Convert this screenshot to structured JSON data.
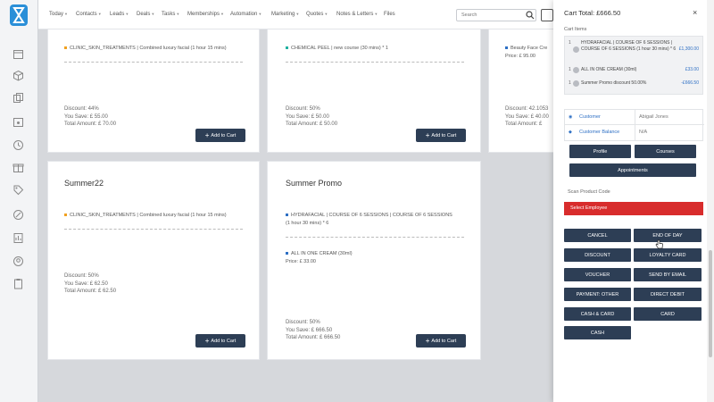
{
  "nav": {
    "items": [
      "Today",
      "Contacts",
      "Leads",
      "Deals",
      "Tasks",
      "Memberships",
      "Automation",
      "Marketing",
      "Quotes",
      "Notes & Letters",
      "Files"
    ],
    "search_placeholder": "Search"
  },
  "rail_icons": [
    "calendar-icon",
    "box-icon",
    "copy-icon",
    "calendar-alt-icon",
    "history-icon",
    "gift-icon",
    "tag-icon",
    "percent-tag-icon",
    "report-icon",
    "user-circle-icon",
    "clipboard-icon"
  ],
  "cards": [
    {
      "title": "",
      "lines": [
        "CLINIC_SKIN_TREATMENTS | Combined luxury facial (1 hour 15 mins)"
      ],
      "bullet_colors": [
        "#f0a020"
      ],
      "discount": "Discount: 44%",
      "save": "You Save: £ 55.00",
      "total": "Total Amount: £ 70.00",
      "button": "Add to Cart"
    },
    {
      "title": "",
      "lines": [
        "CHEMICAL PEEL | new course (30 mins) * 1"
      ],
      "bullet_colors": [
        "#20b0a0"
      ],
      "discount": "Discount: 50%",
      "save": "You Save: £ 50.00",
      "total": "Total Amount: £ 50.00",
      "button": "Add to Cart"
    },
    {
      "title": "",
      "lines": [
        "Beauty Face Cre"
      ],
      "price": "Price: £ 95.00",
      "bullet_colors": [
        "#2d6fc4"
      ],
      "discount": "Discount: 42.1053",
      "save": "You Save: £ 40.00",
      "total": "Total Amount: £",
      "button": ""
    },
    {
      "title": "Summer22",
      "lines": [
        "CLINIC_SKIN_TREATMENTS | Combined luxury facial (1 hour 15 mins)"
      ],
      "bullet_colors": [
        "#f0a020"
      ],
      "discount": "Discount: 50%",
      "save": "You Save: £ 62.50",
      "total": "Total Amount: £ 62.50",
      "button": "Add to Cart"
    },
    {
      "title": "Summer Promo",
      "lines": [
        "HYDRAFACIAL | COURSE OF 6 SESSIONS | COURSE OF 6 SESSIONS",
        "(1 hour 30 mins) * 6",
        "ALL IN ONE CREAM (30ml)",
        "Price: £ 33.00"
      ],
      "bullet_colors": [
        "#2d6fc4",
        "#2d6fc4"
      ],
      "discount": "Discount: 50%",
      "save": "You Save: £ 666.50",
      "total": "Total Amount: £ 666.50",
      "button": "Add to Cart"
    }
  ],
  "cart": {
    "title": "Cart Total: £666.50",
    "close": "×",
    "items_label": "Cart Items",
    "items": [
      {
        "qty": "1",
        "name": "HYDRAFACIAL | COURSE OF 6 SESSIONS | COURSE OF 6 SESSIONS (1 hour 30 mins) * 6",
        "price": "£1,300.00"
      },
      {
        "qty": "1",
        "name": "ALL IN ONE CREAM (30ml)",
        "price": "£33.00"
      },
      {
        "qty": "1",
        "name": "Summer Promo discount 50.00%",
        "price": "-£666.50"
      }
    ],
    "customer_label": "Customer",
    "customer_value": "Abigail Jones",
    "balance_label": "Customer Balance",
    "balance_value": "N/A",
    "buttons_top": [
      "Profile",
      "Courses",
      "Appointments"
    ],
    "scan_label": "Scan Product Code",
    "select_employee": "Select Employee",
    "pay_buttons": [
      "CANCEL",
      "END OF DAY",
      "DISCOUNT",
      "LOYALTY CARD",
      "VOUCHER",
      "SEND BY EMAIL",
      "PAYMENT: OTHER",
      "DIRECT DEBIT",
      "CASH & CARD",
      "CARD",
      "CASH"
    ]
  },
  "colors": {
    "primary": "#2d3e55",
    "danger": "#d82c2c",
    "link": "#2d6fc4",
    "logo": "#2a8fd8"
  }
}
